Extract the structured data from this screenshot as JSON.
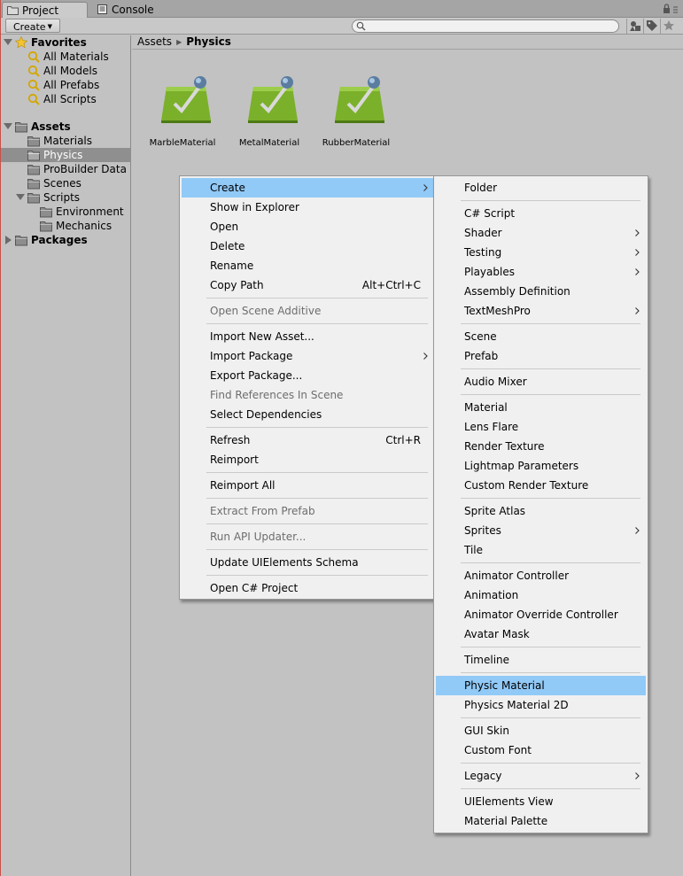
{
  "tabs": [
    {
      "label": "Project",
      "active": true
    },
    {
      "label": "Console",
      "active": false
    }
  ],
  "toolbar": {
    "create_label": "Create",
    "search_value": ""
  },
  "tree": {
    "favorites": {
      "label": "Favorites",
      "items": [
        "All Materials",
        "All Models",
        "All Prefabs",
        "All Scripts"
      ]
    },
    "assets": {
      "label": "Assets",
      "items": [
        "Materials",
        "Physics",
        "ProBuilder Data",
        "Scenes",
        "Scripts"
      ],
      "selected": "Physics",
      "scripts_children": [
        "Environment",
        "Mechanics"
      ]
    },
    "packages_label": "Packages"
  },
  "breadcrumb": {
    "root": "Assets",
    "current": "Physics"
  },
  "assets_grid": [
    {
      "name": "MarbleMaterial"
    },
    {
      "name": "MetalMaterial"
    },
    {
      "name": "RubberMaterial"
    }
  ],
  "context_menu": [
    {
      "label": "Create",
      "submenu": true,
      "highlight": true
    },
    {
      "label": "Show in Explorer"
    },
    {
      "label": "Open"
    },
    {
      "label": "Delete"
    },
    {
      "label": "Rename"
    },
    {
      "label": "Copy Path",
      "shortcut": "Alt+Ctrl+C"
    },
    {
      "separator": true
    },
    {
      "label": "Open Scene Additive",
      "disabled": true
    },
    {
      "separator": true
    },
    {
      "label": "Import New Asset..."
    },
    {
      "label": "Import Package",
      "submenu": true
    },
    {
      "label": "Export Package..."
    },
    {
      "label": "Find References In Scene",
      "disabled": true
    },
    {
      "label": "Select Dependencies"
    },
    {
      "separator": true
    },
    {
      "label": "Refresh",
      "shortcut": "Ctrl+R"
    },
    {
      "label": "Reimport"
    },
    {
      "separator": true
    },
    {
      "label": "Reimport All"
    },
    {
      "separator": true
    },
    {
      "label": "Extract From Prefab",
      "disabled": true
    },
    {
      "separator": true
    },
    {
      "label": "Run API Updater...",
      "disabled": true
    },
    {
      "separator": true
    },
    {
      "label": "Update UIElements Schema"
    },
    {
      "separator": true
    },
    {
      "label": "Open C# Project"
    }
  ],
  "create_submenu": [
    {
      "label": "Folder"
    },
    {
      "separator": true
    },
    {
      "label": "C# Script"
    },
    {
      "label": "Shader",
      "submenu": true
    },
    {
      "label": "Testing",
      "submenu": true
    },
    {
      "label": "Playables",
      "submenu": true
    },
    {
      "label": "Assembly Definition"
    },
    {
      "label": "TextMeshPro",
      "submenu": true
    },
    {
      "separator": true
    },
    {
      "label": "Scene"
    },
    {
      "label": "Prefab"
    },
    {
      "separator": true
    },
    {
      "label": "Audio Mixer"
    },
    {
      "separator": true
    },
    {
      "label": "Material"
    },
    {
      "label": "Lens Flare"
    },
    {
      "label": "Render Texture"
    },
    {
      "label": "Lightmap Parameters"
    },
    {
      "label": "Custom Render Texture"
    },
    {
      "separator": true
    },
    {
      "label": "Sprite Atlas"
    },
    {
      "label": "Sprites",
      "submenu": true
    },
    {
      "label": "Tile"
    },
    {
      "separator": true
    },
    {
      "label": "Animator Controller"
    },
    {
      "label": "Animation"
    },
    {
      "label": "Animator Override Controller"
    },
    {
      "label": "Avatar Mask"
    },
    {
      "separator": true
    },
    {
      "label": "Timeline"
    },
    {
      "separator": true
    },
    {
      "label": "Physic Material",
      "highlight": true
    },
    {
      "label": "Physics Material 2D"
    },
    {
      "separator": true
    },
    {
      "label": "GUI Skin"
    },
    {
      "label": "Custom Font"
    },
    {
      "separator": true
    },
    {
      "label": "Legacy",
      "submenu": true
    },
    {
      "separator": true
    },
    {
      "label": "UIElements View"
    },
    {
      "label": "Material Palette"
    }
  ]
}
